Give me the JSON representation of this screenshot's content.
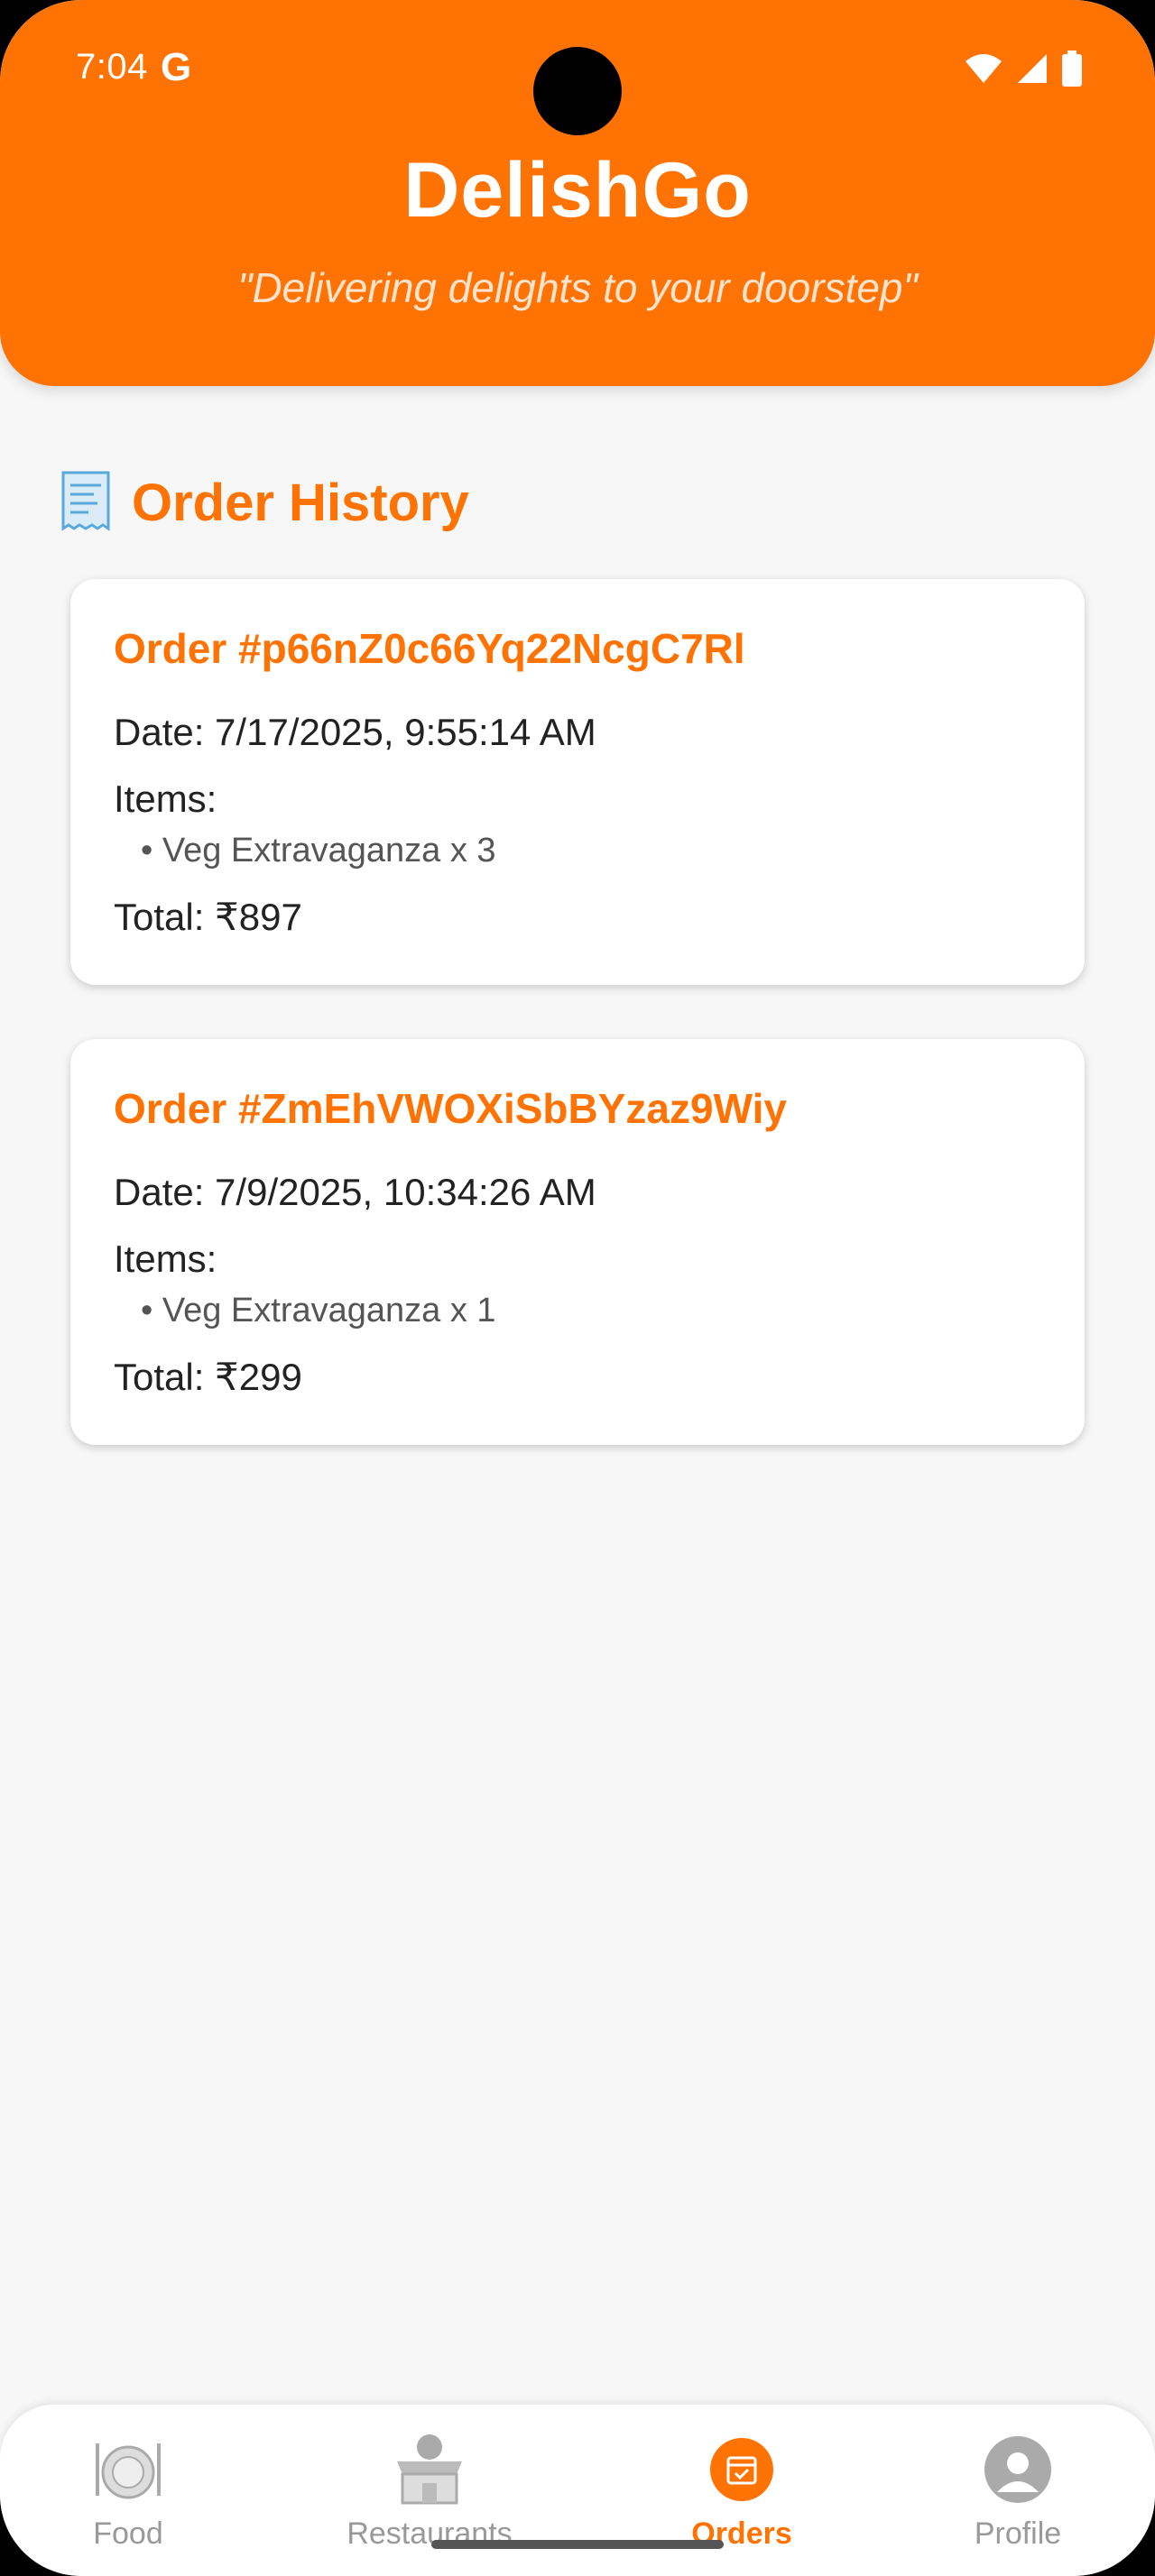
{
  "status_bar": {
    "time": "7:04",
    "g_label": "G"
  },
  "header": {
    "title": "DelishGo",
    "tagline": "\"Delivering delights to your doorstep\""
  },
  "section": {
    "title": "Order History",
    "icon": "receipt-icon"
  },
  "orders": [
    {
      "id": "Order #p66nZ0c66Yq22NcgC7Rl",
      "date": "Date: 7/17/2025, 9:55:14 AM",
      "items_label": "Items:",
      "items": [
        "• Veg Extravaganza x 3"
      ],
      "total": "Total: ₹897"
    },
    {
      "id": "Order #ZmEhVWOXiSbBYzaz9Wiy",
      "date": "Date: 7/9/2025, 10:34:26 AM",
      "items_label": "Items:",
      "items": [
        "• Veg Extravaganza x 1"
      ],
      "total": "Total: ₹299"
    }
  ],
  "nav": {
    "items": [
      {
        "label": "Food",
        "icon": "food-plate-icon",
        "active": false
      },
      {
        "label": "Restaurants",
        "icon": "restaurant-icon",
        "active": false
      },
      {
        "label": "Orders",
        "icon": "orders-icon",
        "active": true
      },
      {
        "label": "Profile",
        "icon": "profile-icon",
        "active": false
      }
    ]
  },
  "colors": {
    "accent": "#ff7304",
    "background": "#f7f7f7"
  }
}
